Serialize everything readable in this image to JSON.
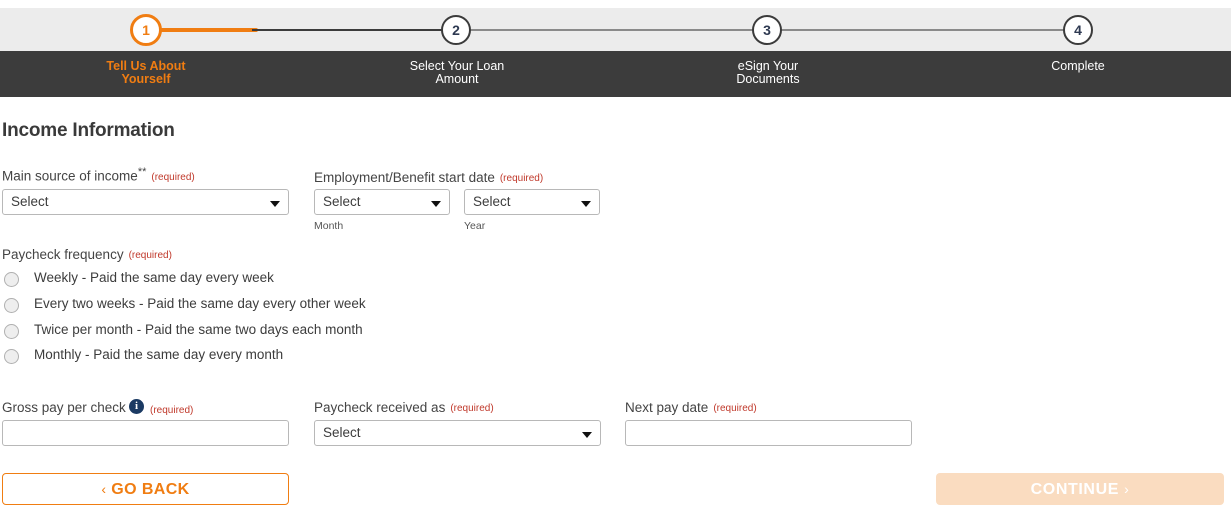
{
  "stepper": {
    "steps": [
      {
        "number": "1",
        "label_line1": "Tell Us About",
        "label_line2": "Yourself",
        "state": "active"
      },
      {
        "number": "2",
        "label_line1": "Select Your Loan",
        "label_line2": "Amount",
        "state": "upcoming"
      },
      {
        "number": "3",
        "label_line1": "eSign Your",
        "label_line2": "Documents",
        "state": "upcoming"
      },
      {
        "number": "4",
        "label_line1": "Complete",
        "label_line2": "",
        "state": "upcoming"
      }
    ],
    "colors": {
      "active_accent": "#f07d12",
      "track_bg": "#ececec",
      "label_bar_bg": "#3c3c3c",
      "label_text": "#ffffff"
    }
  },
  "page": {
    "title": "Income Information"
  },
  "fields": {
    "main_source_of_income": {
      "label": "Main source of income",
      "superscript": "**",
      "required_note": "(required)",
      "value": "Select"
    },
    "employment_start_date": {
      "label": "Employment/Benefit start date",
      "required_note": "(required)",
      "month": {
        "value": "Select",
        "sub_label": "Month"
      },
      "year": {
        "value": "Select",
        "sub_label": "Year"
      }
    },
    "paycheck_frequency": {
      "label": "Paycheck frequency",
      "required_note": "(required)",
      "options": [
        "Weekly - Paid the same day every week",
        "Every two weeks - Paid the same day every other week",
        "Twice per month - Paid the same two days each month",
        "Monthly - Paid the same day every month"
      ],
      "selected": null
    },
    "gross_pay_per_check": {
      "label": "Gross pay per check",
      "required_note": "(required)",
      "info_icon": "info-icon",
      "value": "",
      "placeholder": ""
    },
    "paycheck_received_as": {
      "label": "Paycheck received as",
      "required_note": "(required)",
      "value": "Select"
    },
    "next_pay_date": {
      "label": "Next pay date",
      "required_note": "(required)",
      "value": "",
      "placeholder": ""
    }
  },
  "footer": {
    "back_chevron": "‹",
    "back_label": "GO BACK",
    "continue_label": "CONTINUE",
    "continue_chevron": "›",
    "continue_disabled": true,
    "continue_bg": "#fadcc0",
    "back_border": "#f07d12"
  }
}
